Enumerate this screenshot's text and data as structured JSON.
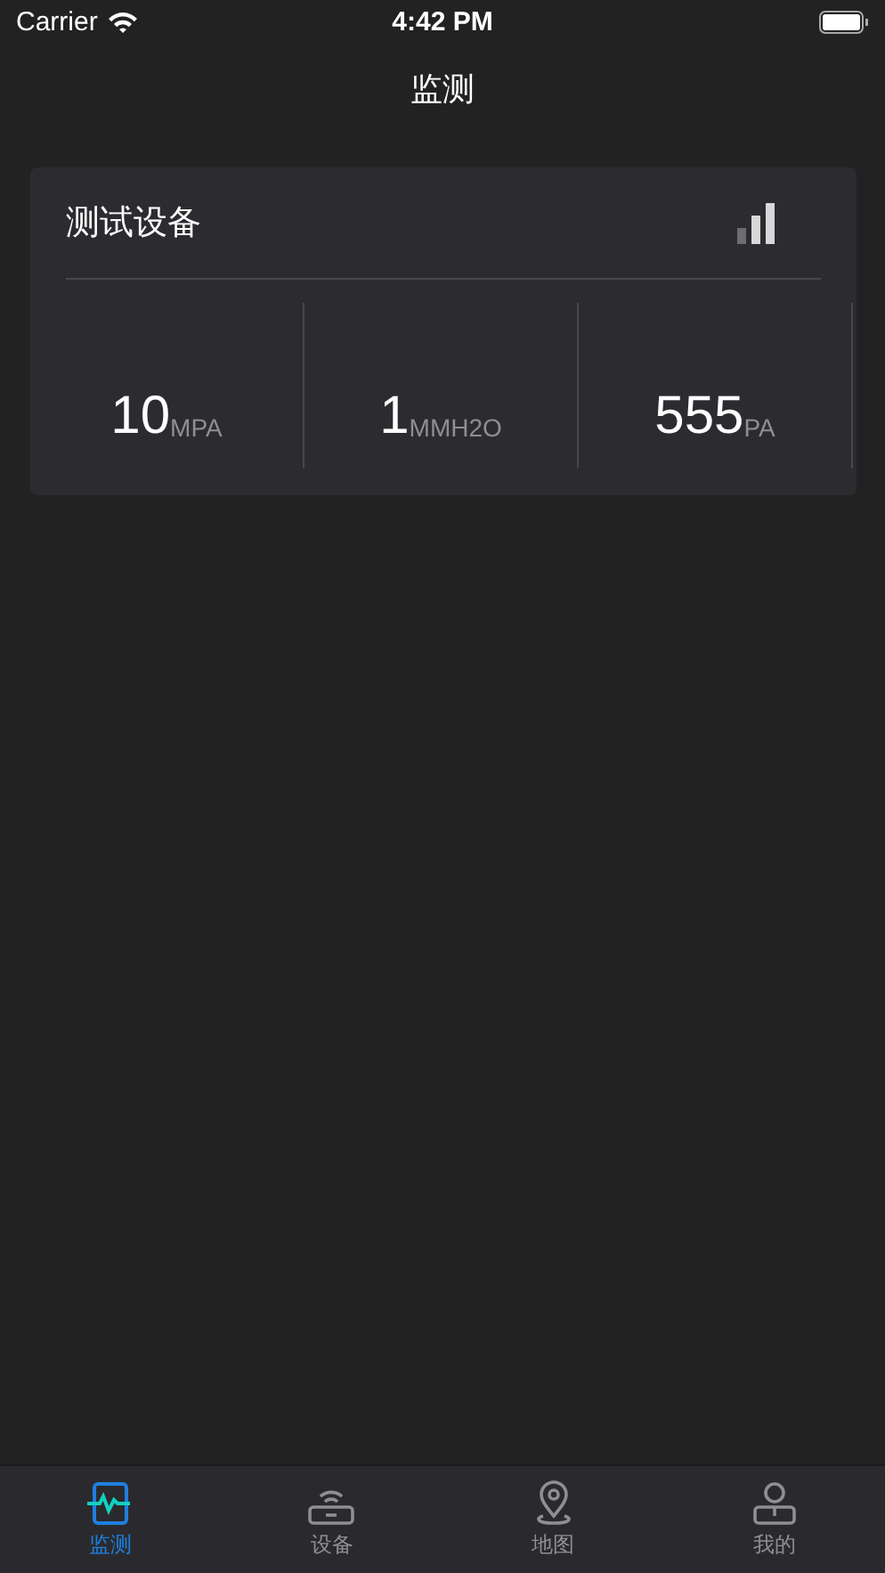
{
  "status_bar": {
    "carrier": "Carrier",
    "time": "4:42 PM"
  },
  "nav": {
    "title": "监测"
  },
  "device": {
    "name": "测试设备",
    "readings": [
      {
        "value": "10",
        "unit": "MPA"
      },
      {
        "value": "1",
        "unit": "MMH2O"
      },
      {
        "value": "555",
        "unit": "PA"
      }
    ]
  },
  "tabs": [
    {
      "kind": "monitor",
      "label": "监测",
      "selected": true
    },
    {
      "kind": "device",
      "label": "设备",
      "selected": false
    },
    {
      "kind": "map",
      "label": "地图",
      "selected": false
    },
    {
      "kind": "profile",
      "label": "我的",
      "selected": false
    }
  ]
}
